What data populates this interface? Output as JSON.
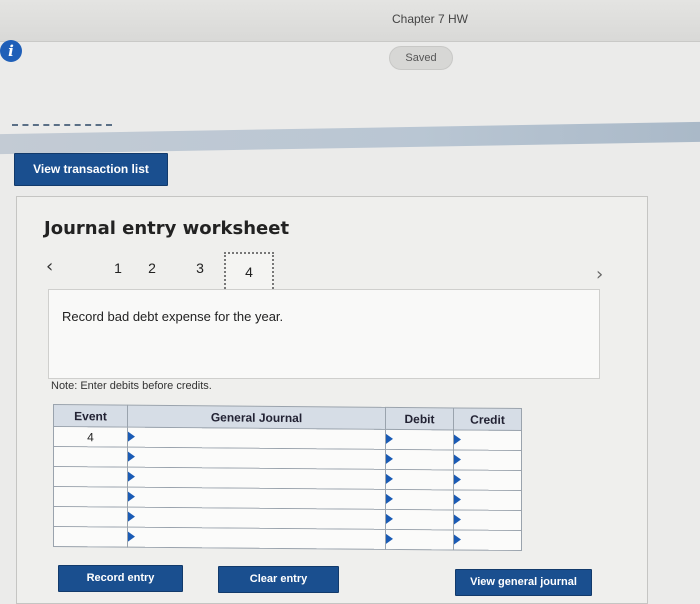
{
  "header": {
    "title": "Chapter 7 HW",
    "saved_label": "Saved",
    "info_glyph": "i"
  },
  "buttons": {
    "view_transaction_list": "View transaction list",
    "record_entry": "Record entry",
    "clear_entry": "Clear entry",
    "view_general_journal": "View general journal"
  },
  "worksheet": {
    "title": "Journal entry worksheet",
    "nav": {
      "prev_glyph": "‹",
      "next_glyph": "›",
      "pages": [
        "1",
        "2",
        "3",
        "4"
      ],
      "active_page": "4"
    },
    "instruction": "Record bad debt expense for the year.",
    "note": "Note: Enter debits before credits.",
    "table": {
      "headers": {
        "event": "Event",
        "general_journal": "General Journal",
        "debit": "Debit",
        "credit": "Credit"
      },
      "rows": [
        {
          "event": "4"
        },
        {
          "event": ""
        },
        {
          "event": ""
        },
        {
          "event": ""
        },
        {
          "event": ""
        },
        {
          "event": ""
        }
      ]
    }
  },
  "colors": {
    "primary_button": "#1a4f8f",
    "info_icon": "#1f5fb8",
    "table_header": "#d6dde6"
  }
}
